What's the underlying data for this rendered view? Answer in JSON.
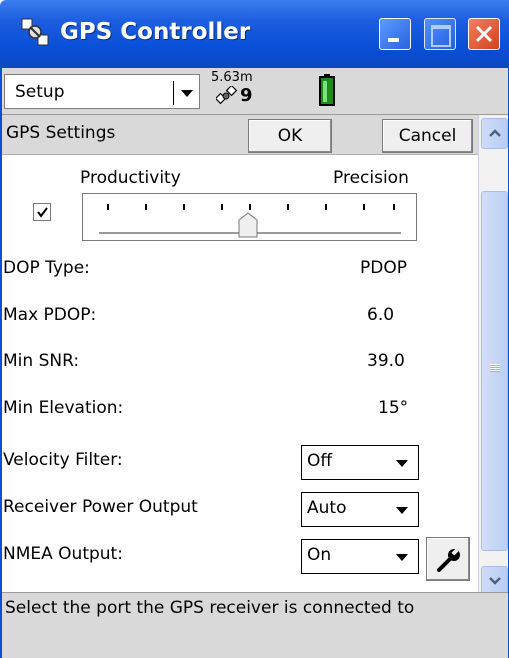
{
  "window": {
    "title": "GPS Controller",
    "title_icon": "satellite-icon"
  },
  "toolbar": {
    "mode_label": "Setup",
    "gps_accuracy": "5.63m",
    "satellite_count": "9",
    "battery_icon": "battery-icon"
  },
  "header": {
    "title": "GPS Settings",
    "ok_label": "OK",
    "cancel_label": "Cancel"
  },
  "slider": {
    "left_label": "Productivity",
    "right_label": "Precision",
    "checkbox_checked": true,
    "position_fraction": 0.5
  },
  "settings": {
    "dop_type_label": "DOP Type:",
    "dop_type_value": "PDOP",
    "max_pdop_label": "Max PDOP:",
    "max_pdop_value": "6.0",
    "min_snr_label": "Min SNR:",
    "min_snr_value": "39.0",
    "min_elevation_label": "Min Elevation:",
    "min_elevation_value": "15°",
    "velocity_filter_label": "Velocity Filter:",
    "velocity_filter_value": "Off",
    "receiver_power_label": "Receiver Power Output",
    "receiver_power_value": "Auto",
    "nmea_output_label": "NMEA Output:",
    "nmea_output_value": "On"
  },
  "status": {
    "text": "Select the port the GPS receiver is connected to"
  },
  "colors": {
    "titlebar": "#0a4fd8",
    "panel": "#d9d9d9",
    "close_button": "#d4401c"
  }
}
